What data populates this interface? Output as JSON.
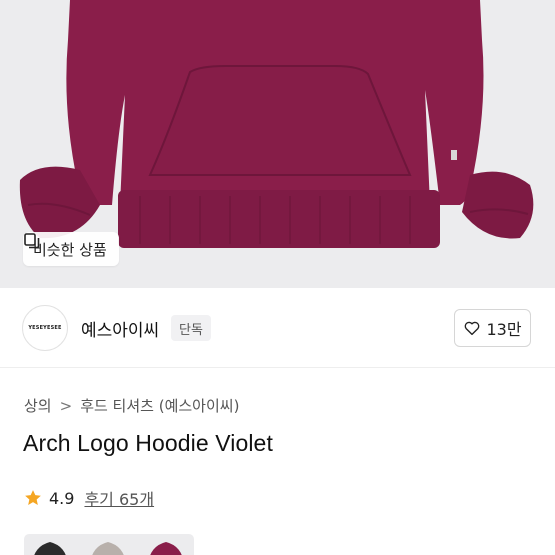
{
  "hero": {
    "similar_label": "비슷한 상품",
    "hoodie_color": "#8a1e4a"
  },
  "shop": {
    "logo_text": "YESEYESEE",
    "name": "예스아이씨",
    "badge": "단독",
    "like_count": "13만"
  },
  "breadcrumb": {
    "root": "상의",
    "separator": ">",
    "category": "후드 티셔츠 (예스아이씨)"
  },
  "product": {
    "title": "Arch Logo Hoodie Violet",
    "rating": "4.9",
    "reviews_label": "후기 65개"
  },
  "colors": {
    "accent_star": "#f5a623",
    "thumb_colors": [
      "#2b2b2b",
      "#b8b0ab",
      "#8a1e4a"
    ]
  }
}
